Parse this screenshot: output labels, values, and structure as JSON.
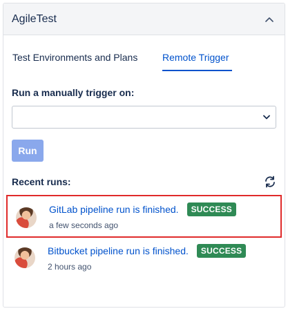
{
  "panel": {
    "title": "AgileTest"
  },
  "tabs": [
    {
      "label": "Test Environments and Plans",
      "active": false
    },
    {
      "label": "Remote Trigger",
      "active": true
    }
  ],
  "trigger": {
    "label": "Run a manually trigger on:",
    "selected_value": ""
  },
  "run_button": {
    "label": "Run"
  },
  "recent": {
    "label": "Recent runs:",
    "runs": [
      {
        "title": "GitLab pipeline run is finished.",
        "status": "SUCCESS",
        "time": "a few seconds ago"
      },
      {
        "title": "Bitbucket pipeline run is finished.",
        "status": "SUCCESS",
        "time": "2 hours ago"
      }
    ]
  },
  "colors": {
    "accent": "#0052cc",
    "success": "#2f8a55",
    "run_button": "#8aa8ec",
    "highlight": "#e02a2a"
  },
  "icons": {
    "collapse": "chevron-up-icon",
    "select": "chevron-down-icon",
    "refresh": "refresh-icon"
  }
}
